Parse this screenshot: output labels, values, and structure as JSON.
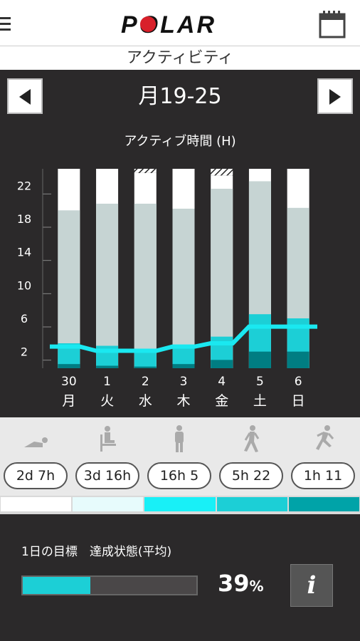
{
  "header": {
    "brand": "POLAR",
    "subtitle": "アクティビティ"
  },
  "week": {
    "label": "月19-25"
  },
  "chart_data": {
    "type": "bar",
    "title": "アクティブ時間 (H)",
    "y_ticks": [
      "22",
      "18",
      "14",
      "10",
      "6",
      "2"
    ],
    "categories": [
      "30",
      "1",
      "2",
      "3",
      "4",
      "5",
      "6"
    ],
    "weekdays": [
      "月",
      "火",
      "水",
      "木",
      "金",
      "土",
      "日"
    ],
    "ylim": [
      0,
      24
    ],
    "total": [
      24,
      24,
      23.5,
      24,
      23.2,
      24,
      24
    ],
    "hatched": [
      false,
      false,
      true,
      false,
      true,
      true,
      false
    ],
    "series": [
      {
        "color": "#007d82",
        "values": [
          0.5,
          0.3,
          0.2,
          0.5,
          1.0,
          2.0,
          2.0
        ]
      },
      {
        "color": "#1ccfd6",
        "values": [
          2.5,
          2.4,
          2.0,
          2.2,
          2.8,
          4.5,
          4.0
        ]
      },
      {
        "color": "#c6d4d3",
        "values": [
          16.0,
          17.1,
          17.6,
          16.5,
          17.8,
          16.0,
          13.3
        ]
      }
    ],
    "goal_line": {
      "color": "#1ae8f0",
      "values": [
        2.6,
        2.1,
        2.1,
        2.6,
        3.0,
        5.0,
        5.0
      ]
    }
  },
  "activity": {
    "items": [
      {
        "time": "2d 7h",
        "icon": "lying-person-icon"
      },
      {
        "time": "3d 16h",
        "icon": "sitting-person-icon"
      },
      {
        "time": "16h 5",
        "icon": "standing-person-icon"
      },
      {
        "time": "5h 22",
        "icon": "walking-person-icon"
      },
      {
        "time": "1h 11",
        "icon": "running-person-icon"
      }
    ],
    "strip_colors": [
      "#ffffff",
      "#e7fbfc",
      "#18f0f7",
      "#1ccfd6",
      "#00a3a8"
    ]
  },
  "goal": {
    "label": "1日の目標　達成状態(平均)",
    "percent": "39",
    "percent_unit": "%",
    "fraction": 0.39,
    "info": "i"
  }
}
